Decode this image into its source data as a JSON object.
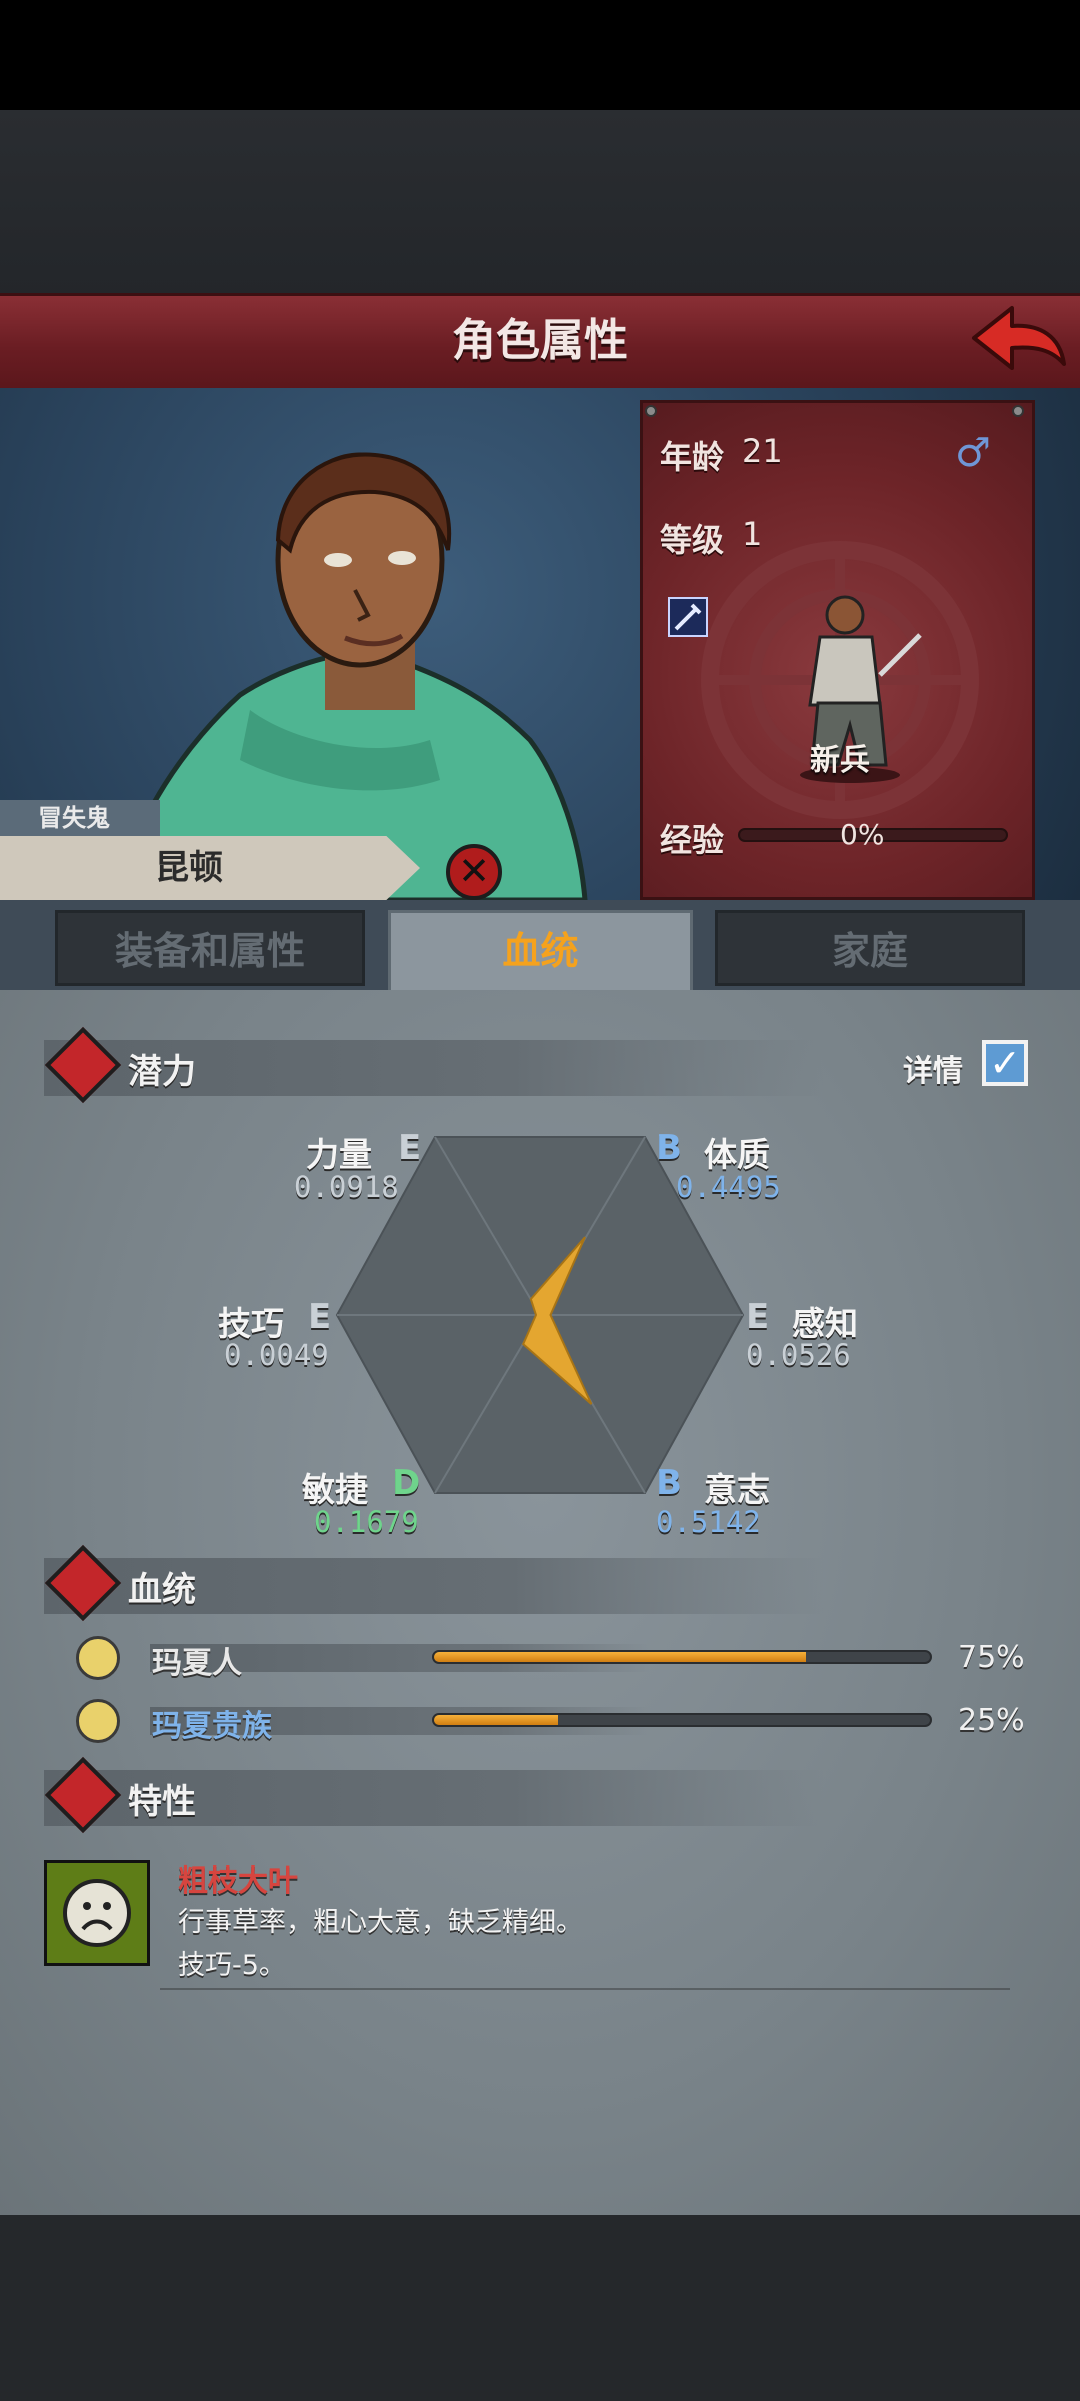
{
  "header": {
    "title": "角色属性"
  },
  "character": {
    "nickname": "冒失鬼",
    "name": "昆顿",
    "age_label": "年龄",
    "age": "21",
    "gender_symbol": "♂",
    "level_label": "等级",
    "level": "1",
    "class_name": "新兵",
    "xp_label": "经验",
    "xp_text": "0%",
    "xp_fraction": 0
  },
  "tabs": [
    {
      "label": "装备和属性",
      "active": false
    },
    {
      "label": "血统",
      "active": true
    },
    {
      "label": "家庭",
      "active": false
    }
  ],
  "potential": {
    "title": "潜力",
    "detail_label": "详情",
    "detail_checked": true,
    "stats": [
      {
        "name": "力量",
        "grade": "E",
        "value": "0.0918",
        "color": "#c9d0d6"
      },
      {
        "name": "体质",
        "grade": "B",
        "value": "0.4495",
        "color": "#7fb3ea"
      },
      {
        "name": "感知",
        "grade": "E",
        "value": "0.0526",
        "color": "#c9d0d6"
      },
      {
        "name": "意志",
        "grade": "B",
        "value": "0.5142",
        "color": "#7fb3ea"
      },
      {
        "name": "敏捷",
        "grade": "D",
        "value": "0.1679",
        "color": "#6fd48c"
      },
      {
        "name": "技巧",
        "grade": "E",
        "value": "0.0049",
        "color": "#c9d0d6"
      }
    ]
  },
  "bloodline": {
    "title": "血统",
    "items": [
      {
        "name": "玛夏人",
        "percent_text": "75%",
        "fraction": 0.75,
        "name_color": "#f2f2f2"
      },
      {
        "name": "玛夏贵族",
        "percent_text": "25%",
        "fraction": 0.25,
        "name_color": "#7fb3ea"
      }
    ]
  },
  "traits": {
    "title": "特性",
    "items": [
      {
        "name": "粗枝大叶",
        "description": "行事草率，粗心大意，缺乏精细。",
        "effect": "技巧-5。",
        "icon": "sad-face-icon"
      }
    ]
  }
}
